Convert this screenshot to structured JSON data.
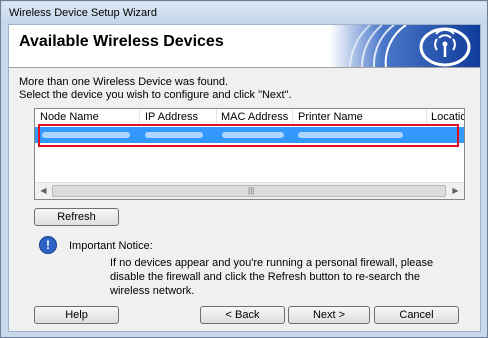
{
  "window": {
    "title": "Wireless Device Setup Wizard"
  },
  "header": {
    "title": "Available Wireless Devices",
    "logo_icon": "wireless-signal-icon"
  },
  "message": {
    "line1": "More than one Wireless Device was found.",
    "line2": "Select the device you wish to configure and click \"Next\"."
  },
  "device_list": {
    "columns": [
      "Node Name",
      "IP Address",
      "MAC Address",
      "Printer Name",
      "Location"
    ],
    "selected_row_blurred": true
  },
  "buttons": {
    "refresh": "Refresh",
    "help": "Help",
    "back": "< Back",
    "next": "Next >",
    "cancel": "Cancel"
  },
  "notice": {
    "title": "Important Notice:",
    "lines": [
      "If no devices appear and you're running a personal firewall, please",
      "disable the firewall and click the Refresh button to re-search the",
      "wireless network."
    ]
  },
  "colors": {
    "selection": "#3399ff",
    "highlight_box": "#e0101e",
    "logo_blue": "#1a4fb5"
  }
}
